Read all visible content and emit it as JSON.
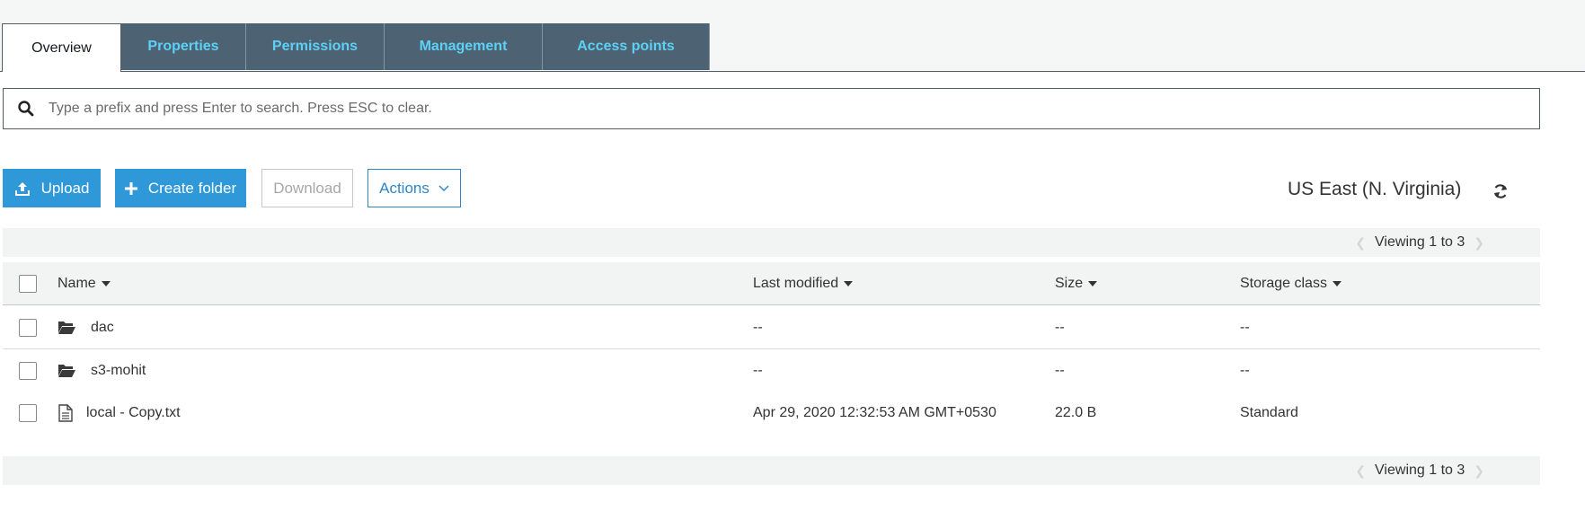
{
  "tabs": [
    {
      "label": "Overview",
      "active": true
    },
    {
      "label": "Properties",
      "active": false
    },
    {
      "label": "Permissions",
      "active": false
    },
    {
      "label": "Management",
      "active": false
    },
    {
      "label": "Access points",
      "active": false
    }
  ],
  "search": {
    "placeholder": "Type a prefix and press Enter to search. Press ESC to clear.",
    "value": ""
  },
  "toolbar": {
    "upload_label": "Upload",
    "create_folder_label": "Create folder",
    "download_label": "Download",
    "actions_label": "Actions"
  },
  "region": "US East (N. Virginia)",
  "pager": {
    "top_text": "Viewing 1 to 3",
    "bottom_text": "Viewing 1 to 3"
  },
  "table": {
    "columns": {
      "name": "Name",
      "last_modified": "Last modified",
      "size": "Size",
      "storage_class": "Storage class"
    },
    "rows": [
      {
        "type": "folder",
        "name": "dac",
        "last_modified": "--",
        "size": "--",
        "storage_class": "--"
      },
      {
        "type": "folder",
        "name": "s3-mohit",
        "last_modified": "--",
        "size": "--",
        "storage_class": "--"
      },
      {
        "type": "file",
        "name": "local - Copy.txt",
        "last_modified": "Apr 29, 2020 12:32:53 AM GMT+0530",
        "size": "22.0 B",
        "storage_class": "Standard"
      }
    ]
  },
  "colors": {
    "tab_bg": "#4d6272",
    "tab_text": "#5dd0f5",
    "primary": "#2e98d8",
    "outline": "#2e86c6"
  },
  "icons": {
    "search": "search-icon",
    "upload": "upload-icon",
    "create_folder": "plus-icon",
    "actions": "chevron-down-icon",
    "refresh": "refresh-icon",
    "folder": "folder-open-icon",
    "file": "file-text-icon"
  }
}
